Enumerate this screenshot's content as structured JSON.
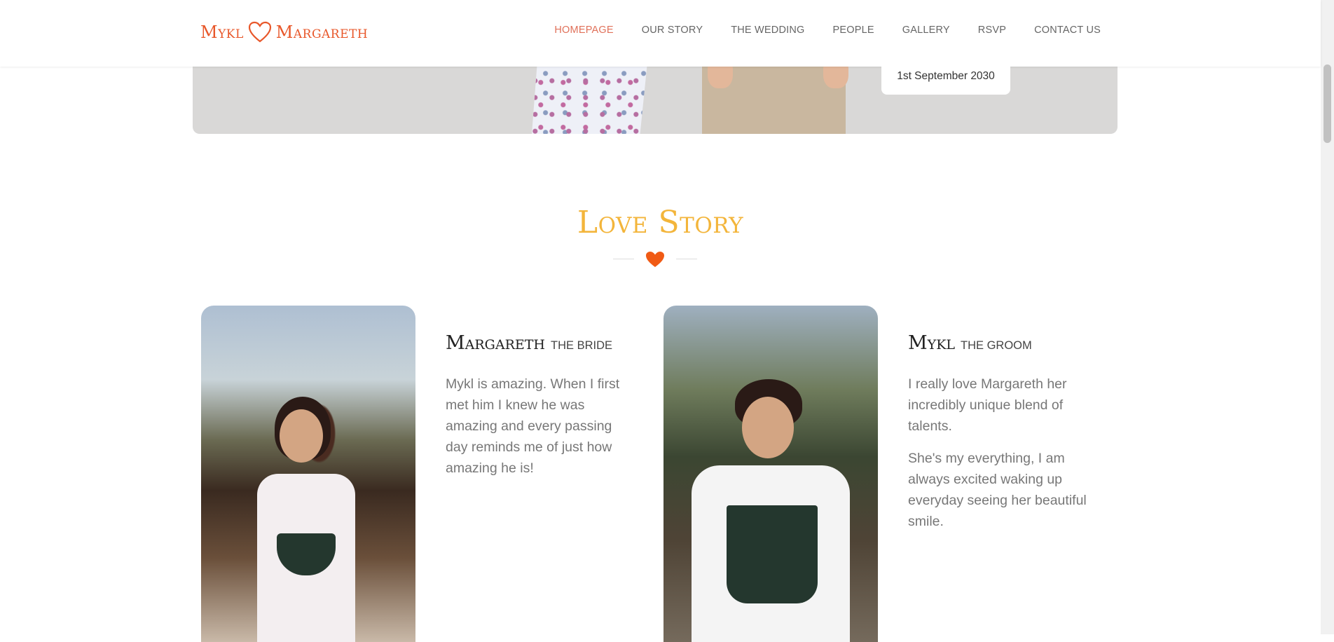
{
  "brand": {
    "left": "Mykl",
    "right": "Margareth",
    "accent": "#e8572a"
  },
  "nav": {
    "items": [
      "HOMEPAGE",
      "OUR STORY",
      "THE WEDDING",
      "PEOPLE",
      "GALLERY",
      "RSVP",
      "CONTACT US"
    ],
    "active_index": 0
  },
  "hero": {
    "date": "1st September 2030"
  },
  "love_story": {
    "title": "Love Story",
    "title_color": "#f3b53b",
    "heart_color": "#f05a14",
    "bride": {
      "name": "Margareth",
      "role": "THE BRIDE",
      "paragraphs": [
        "Mykl is amazing. When I first met him I knew he was amazing and every passing day reminds me of just how amazing he is!"
      ]
    },
    "groom": {
      "name": "Mykl",
      "role": "THE GROOM",
      "paragraphs": [
        "I really love Margareth her incredibly unique blend of talents.",
        "She's my everything, I am always excited waking up everyday seeing her beautiful smile."
      ]
    }
  }
}
